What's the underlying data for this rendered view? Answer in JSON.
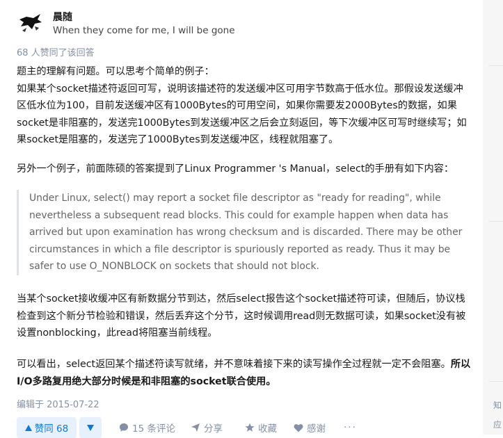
{
  "author": {
    "name": "晨随",
    "bio": "When they come for me, I will be gone"
  },
  "voters_text": "68 人赞同了该回答",
  "answer": {
    "p1_line1": "题主的理解有问题。可以思考个简单的例子：",
    "p1_rest": "如果某个socket描述符返回可写，说明该描述符的发送缓冲区可用字节数高于低水位。那假设发送缓冲区低水位为100，目前发送缓冲区有1000Bytes的可用空间，如果你需要发2000Bytes的数据，如果socket是非阻塞的，发送完1000Bytes到发送缓冲区之后会立刻返回，等下次缓冲区可写时继续写；如果socket是阻塞的，发送完了1000Bytes到发送缓冲区，线程就阻塞了。",
    "p2": "另外一个例子，前面陈硕的答案提到了Linux Programmer 's Manual，select的手册有如下内容：",
    "quote": "Under Linux, select() may report a socket file descriptor as \"ready for reading\", while nevertheless a subsequent read blocks. This could for example happen when data has arrived but upon examination has wrong checksum and is discarded. There may be other circumstances in which a file descriptor is spuriously reported as ready. Thus it may be safer to use O_NONBLOCK on sockets that should not block.",
    "p3": "当某个socket接收缓冲区有新数据分节到达，然后select报告这个socket描述符可读，但随后，协议栈检查到这个新分节检验和错误，然后丢弃这个分节，这时候调用read则无数据可读，如果socket没有被设置nonblocking，此read将阻塞当前线程。",
    "p4_normal": "可以看出，select返回某个描述符读写就绪，并不意味着接下来的读写操作全过程就一定不会阻塞。",
    "p4_bold": "所以I/O多路复用绝大部分时候是和非阻塞的socket联合使用。"
  },
  "edited": "编辑于 2015-07-22",
  "actions": {
    "vote_up": "赞同 68",
    "comments": "15 条评论",
    "share": "分享",
    "favorite": "收藏",
    "thanks": "感谢",
    "more": "···"
  },
  "right_rail": {
    "char1": "知",
    "char2": "应"
  },
  "colors": {
    "accent": "#0f78d8",
    "meta": "#8590a6",
    "vote_bg": "#e7f1fd"
  }
}
